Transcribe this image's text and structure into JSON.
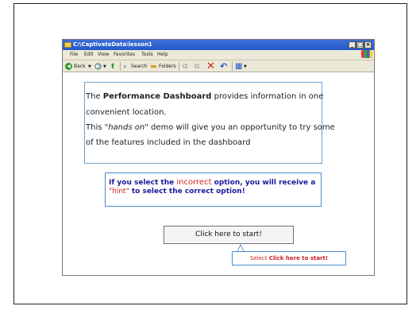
{
  "window": {
    "title": "C:\\CaptivateData\\lesson1",
    "minimize": "_",
    "maximize": "□",
    "close": "×"
  },
  "menu": [
    "File",
    "Edit",
    "View",
    "Favorites",
    "Tools",
    "Help"
  ],
  "toolbar": {
    "back": "Back",
    "search": "Search",
    "folders": "Folders"
  },
  "info": {
    "line1_pre": "The ",
    "line1_bold": "Performance Dashboard",
    "line1_post": " provides information in one",
    "line2": "convenient location.",
    "line3_pre": "This \"",
    "line3_em": "hands on",
    "line3_post": "\" demo will give you an opportunity to try some",
    "line4": "of the features included in the dashboard"
  },
  "hint": {
    "pre": "If you select the ",
    "incorrect": "incorrect",
    "mid": " option, you will receive a",
    "hint_word": "\"hint\"",
    "post": " to select the correct option!"
  },
  "start_button": "Click here to start!",
  "caption": {
    "pre": "Select ",
    "bold": "Click here to start!"
  },
  "colors": {
    "titlebar": "#2459c7",
    "accent_red": "#d32020",
    "hint_blue": "#1a1a9c",
    "box_border": "#4a8ad0"
  }
}
